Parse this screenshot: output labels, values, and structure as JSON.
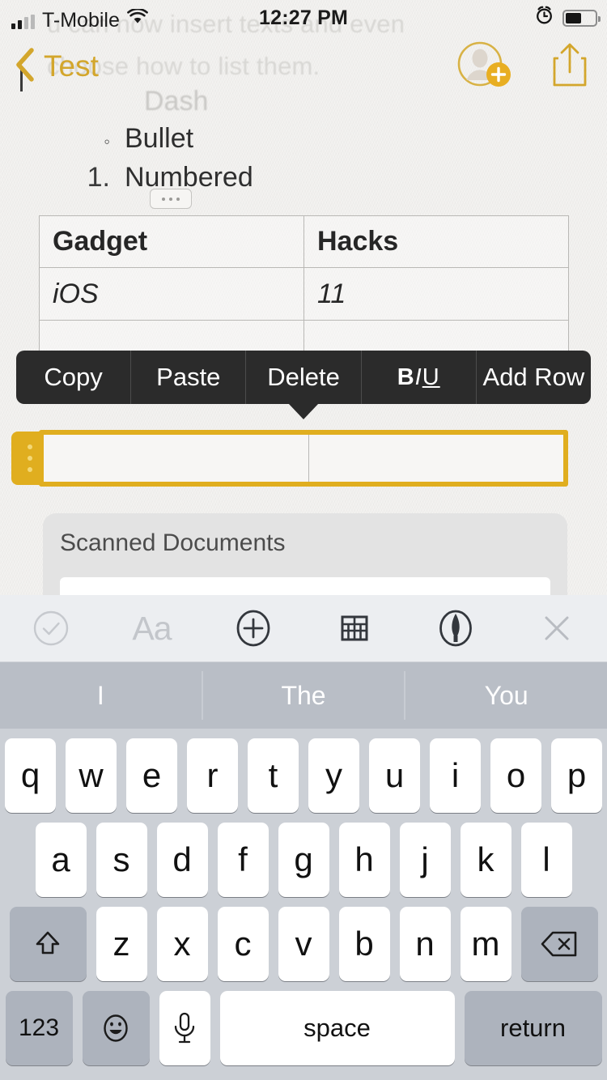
{
  "status_bar": {
    "carrier": "T-Mobile",
    "time": "12:27 PM",
    "wifi_icon": "wifi-icon",
    "alarm_icon": "alarm-clock-icon",
    "battery_icon": "battery-icon",
    "battery_level": "55"
  },
  "nav_bar": {
    "back_label": "Test",
    "back_chevron_icon": "chevron-left-icon",
    "add_person_icon": "add-person-icon",
    "share_icon": "share-icon",
    "accent_color": "#d3a62c"
  },
  "note": {
    "ghost_text": "u can now insert texts and even\nchoose how to list them.",
    "ghost_dash": "Dash",
    "list_items": [
      {
        "marker": "◦",
        "label": "Bullet"
      },
      {
        "marker": "1.",
        "label": "Numbered"
      }
    ],
    "handle_icon": "drag-handle-dots-icon",
    "table": {
      "headers": [
        "Gadget",
        "Hacks"
      ],
      "rows": [
        [
          "iOS",
          "11"
        ],
        [
          "",
          ""
        ]
      ],
      "selected_row_index": 2,
      "selection_color": "#e0ae1f",
      "row_handle_icon": "row-handle-dots-icon"
    }
  },
  "context_menu": {
    "items": [
      {
        "label": "Copy",
        "name": "copy"
      },
      {
        "label": "Paste",
        "name": "paste"
      },
      {
        "label": "Delete",
        "name": "delete"
      },
      {
        "label": "BIU",
        "name": "bold-italic-underline",
        "bold": "B",
        "italic": "I",
        "underline": "U"
      },
      {
        "label": "Add Row",
        "name": "add-row"
      }
    ],
    "background_color": "#2b2b2b"
  },
  "scanned_card": {
    "title": "Scanned Documents"
  },
  "format_toolbar": {
    "buttons": [
      {
        "name": "checklist-icon",
        "state": "dim"
      },
      {
        "name": "text-format-icon",
        "label": "Aa",
        "state": "dim"
      },
      {
        "name": "plus-circle-icon",
        "state": "active"
      },
      {
        "name": "table-icon",
        "state": "active"
      },
      {
        "name": "markup-pen-icon",
        "state": "active"
      },
      {
        "name": "close-icon",
        "state": "dim"
      }
    ]
  },
  "predictive_bar": {
    "suggestions": [
      "I",
      "The",
      "You"
    ],
    "background_color": "#b9bec6"
  },
  "keyboard": {
    "row1": [
      "q",
      "w",
      "e",
      "r",
      "t",
      "y",
      "u",
      "i",
      "o",
      "p"
    ],
    "row2": [
      "a",
      "s",
      "d",
      "f",
      "g",
      "h",
      "j",
      "k",
      "l"
    ],
    "row3": [
      "z",
      "x",
      "c",
      "v",
      "b",
      "n",
      "m"
    ],
    "shift_icon": "shift-icon",
    "backspace_icon": "backspace-icon",
    "numbers_label": "123",
    "emoji_icon": "emoji-icon",
    "mic_icon": "microphone-icon",
    "space_label": "space",
    "return_label": "return",
    "background_color": "#ccd0d6"
  }
}
